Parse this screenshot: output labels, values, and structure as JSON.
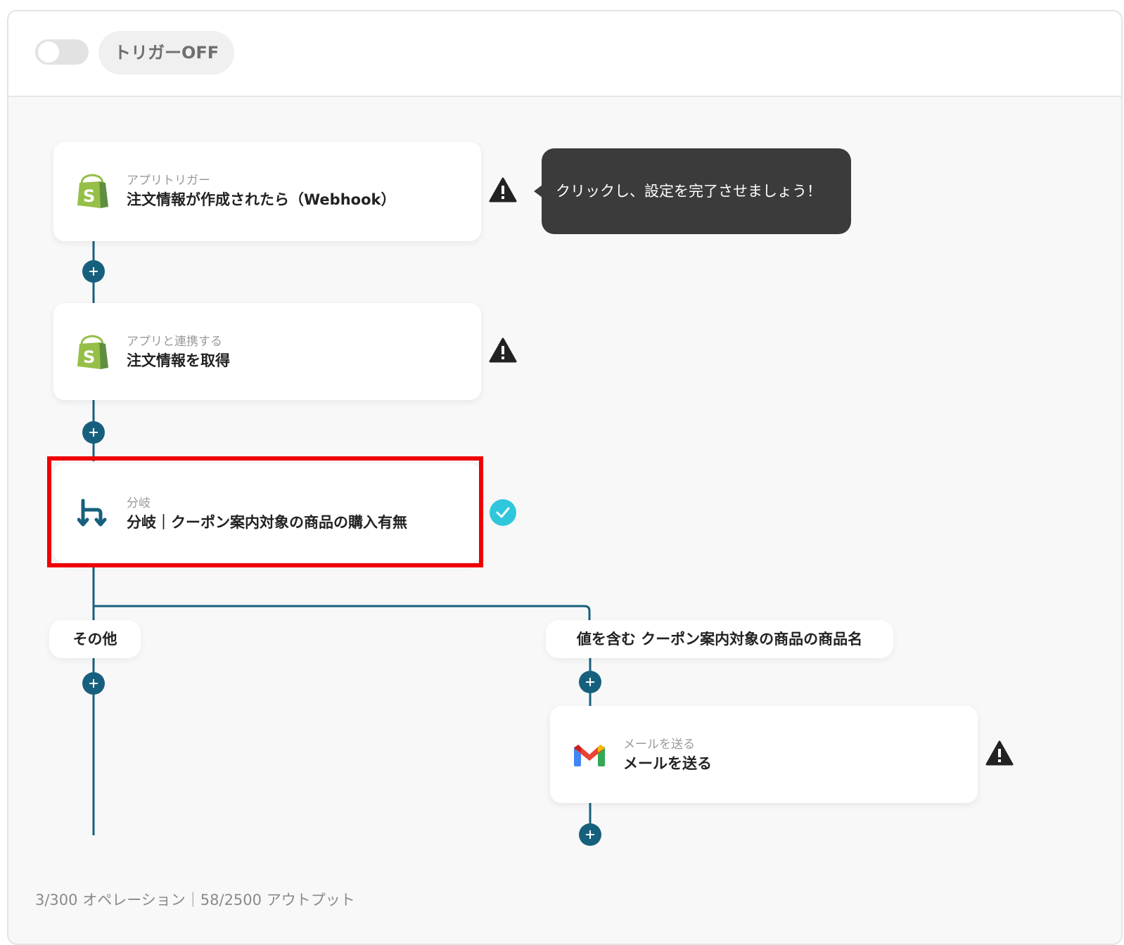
{
  "topbar": {
    "toggle_state": "off",
    "trigger_label": "トリガーOFF"
  },
  "steps": [
    {
      "kind": "app-trigger",
      "icon": "shopify-icon",
      "subtitle": "アプリトリガー",
      "title": "注文情報が作成されたら（Webhook）",
      "status": "warning"
    },
    {
      "kind": "app-action",
      "icon": "shopify-icon",
      "subtitle": "アプリと連携する",
      "title": "注文情報を取得",
      "status": "warning"
    },
    {
      "kind": "branch",
      "icon": "branch-icon",
      "subtitle": "分岐",
      "title": "分岐｜クーポン案内対象の商品の購入有無",
      "status": "complete",
      "highlighted": true
    },
    {
      "kind": "app-action",
      "icon": "gmail-icon",
      "subtitle": "メールを送る",
      "title": "メールを送る",
      "status": "warning"
    }
  ],
  "tooltip": {
    "text": "クリックし、設定を完了させましょう！"
  },
  "branches": [
    {
      "label": "その他"
    },
    {
      "label": "値を含む クーポン案内対象の商品の商品名"
    }
  ],
  "footer": {
    "stats": "3/300 オペレーション｜58/2500 アウトプット"
  },
  "colors": {
    "connector": "#17607d",
    "highlight_border": "#ee0000",
    "check": "#2ec7db",
    "tooltip_bg": "#3b3b3b",
    "shopify_green": "#95bf47",
    "shopify_dark": "#5e8e3e"
  }
}
